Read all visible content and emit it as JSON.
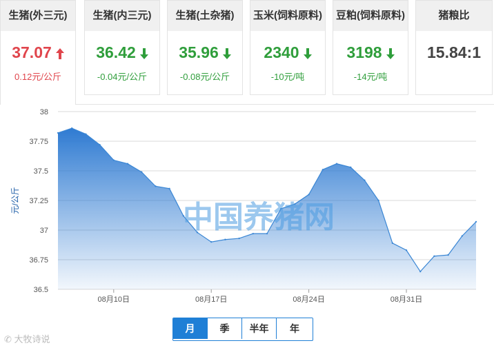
{
  "cards": [
    {
      "title": "生猪(外三元)",
      "price": "37.07",
      "change": "0.12元/公斤",
      "dir": "up"
    },
    {
      "title": "生猪(内三元)",
      "price": "36.42",
      "change": "-0.04元/公斤",
      "dir": "down"
    },
    {
      "title": "生猪(土杂猪)",
      "price": "35.96",
      "change": "-0.08元/公斤",
      "dir": "down"
    },
    {
      "title": "玉米(饲料原料)",
      "price": "2340",
      "change": "-10元/吨",
      "dir": "down"
    },
    {
      "title": "豆粕(饲料原料)",
      "price": "3198",
      "change": "-14元/吨",
      "dir": "down"
    },
    {
      "title": "猪粮比",
      "price": "15.84:1",
      "change": "",
      "dir": "none"
    }
  ],
  "chart_data": {
    "type": "area",
    "ylabel": "元/公斤",
    "ylim": [
      36.5,
      38
    ],
    "yticks": [
      "36.5",
      "36.75",
      "37",
      "37.25",
      "37.5",
      "37.75",
      "38"
    ],
    "xtick_labels": [
      "08月10日",
      "08月17日",
      "08月24日",
      "08月31日"
    ],
    "watermark": "中国养猪网",
    "grid": true,
    "series": [
      {
        "values": [
          37.82,
          37.86,
          37.81,
          37.72,
          37.59,
          37.56,
          37.49,
          37.37,
          37.35,
          37.12,
          36.98,
          36.9,
          36.92,
          36.93,
          36.97,
          36.97,
          37.18,
          37.22,
          37.3,
          37.51,
          37.56,
          37.53,
          37.42,
          37.25,
          36.89,
          36.83,
          36.65,
          36.78,
          36.79,
          36.95,
          37.07
        ]
      }
    ]
  },
  "periods": [
    "月",
    "季",
    "半年",
    "年"
  ],
  "selected_period": "月",
  "colors": {
    "up": "#e0454c",
    "down": "#2f9e3b",
    "accent": "#1f7fd6",
    "line": "#3a86d4"
  },
  "footer": "大牧诗说"
}
